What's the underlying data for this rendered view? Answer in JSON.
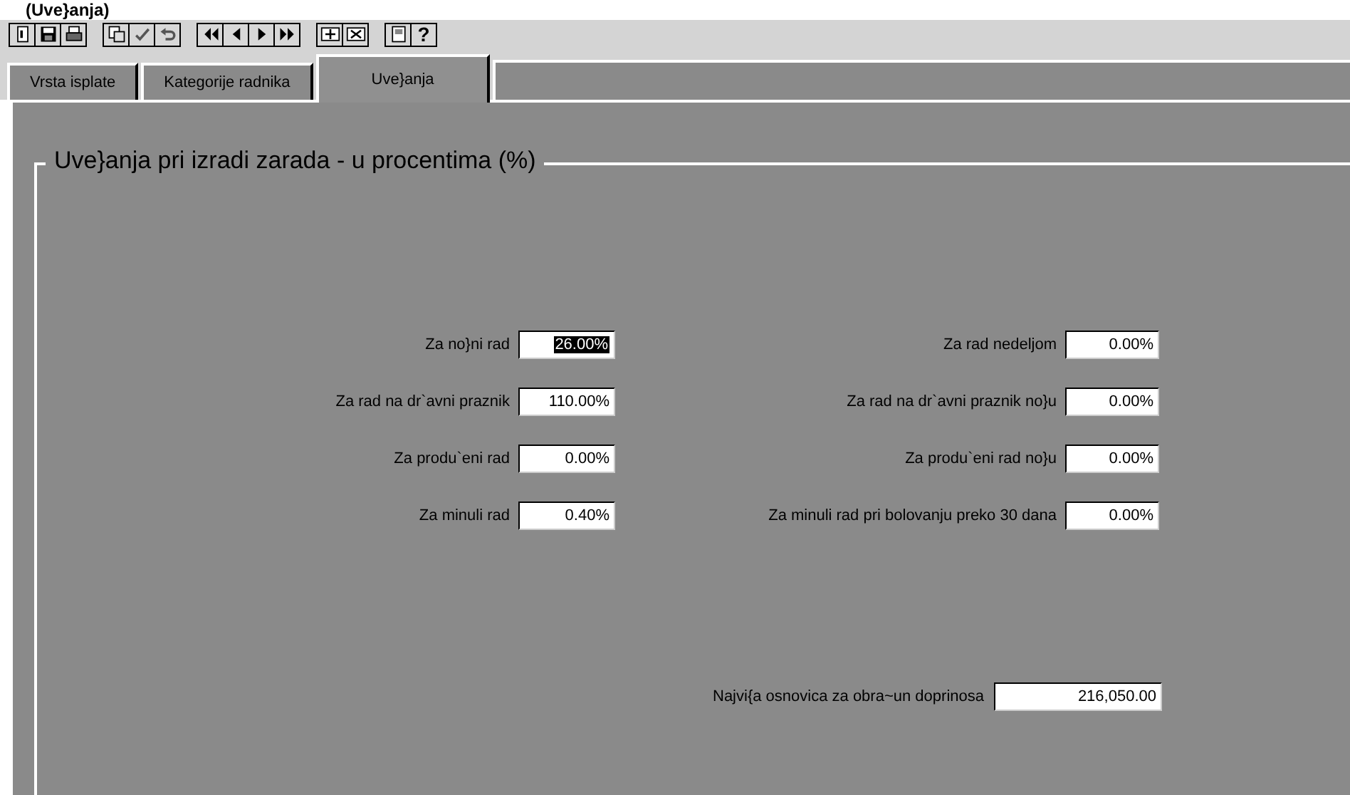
{
  "caption": "(Uve}anja)",
  "toolbar": [
    {
      "buttons": [
        {
          "kind": "new"
        },
        {
          "kind": "save"
        },
        {
          "kind": "print"
        }
      ]
    },
    {
      "buttons": [
        {
          "kind": "copy"
        },
        {
          "kind": "check"
        },
        {
          "kind": "undo"
        }
      ]
    },
    {
      "buttons": [
        {
          "kind": "first"
        },
        {
          "kind": "prev"
        },
        {
          "kind": "next"
        },
        {
          "kind": "last"
        }
      ]
    },
    {
      "buttons": [
        {
          "kind": "insert"
        },
        {
          "kind": "delete"
        }
      ]
    },
    {
      "buttons": [
        {
          "kind": "page"
        },
        {
          "kind": "help",
          "label": "?"
        }
      ]
    }
  ],
  "tabs": [
    {
      "label": "Vrsta isplate",
      "selected": false
    },
    {
      "label": "Kategorije radnika",
      "selected": false
    },
    {
      "label": "Uve}anja",
      "selected": true
    }
  ],
  "group": {
    "title": "Uve}anja pri izradi zarada - u procentima (%)",
    "fields": [
      {
        "label": "Za no}ni rad",
        "value": "26.00%",
        "selected": true
      },
      {
        "label": "Za rad nedeljom",
        "value": "0.00%",
        "selected": false
      },
      {
        "label": "Za rad na dr`avni praznik",
        "value": "110.00%",
        "selected": false
      },
      {
        "label": "Za rad na dr`avni praznik no}u",
        "value": "0.00%",
        "selected": false
      },
      {
        "label": "Za produ`eni rad",
        "value": "0.00%",
        "selected": false
      },
      {
        "label": "Za produ`eni rad no}u",
        "value": "0.00%",
        "selected": false
      },
      {
        "label": "Za minuli rad",
        "value": "0.40%",
        "selected": false
      },
      {
        "label": "Za minuli rad pri bolovanju preko 30 dana",
        "value": "0.00%",
        "selected": false
      }
    ],
    "base": {
      "label": "Najvi{a osnovica za obra~un doprinosa",
      "value": "216,050.00"
    }
  }
}
